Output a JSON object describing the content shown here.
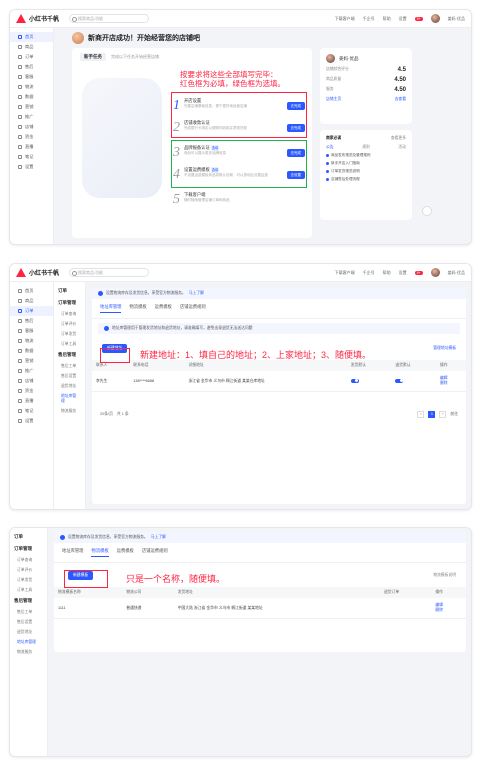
{
  "app": {
    "logo_text": "小红书千帆",
    "search_placeholder": "搜索商品/功能",
    "top_links": [
      "下载客户端",
      "千企号",
      "帮助",
      "设置"
    ],
    "user_name": "姜妈·优品",
    "notif_count": "9+"
  },
  "panel1": {
    "sidebar": [
      {
        "label": "首页",
        "active": true
      },
      {
        "label": "商品"
      },
      {
        "label": "订单"
      },
      {
        "label": "售后"
      },
      {
        "label": "客服"
      },
      {
        "label": "物流"
      },
      {
        "label": "数据"
      },
      {
        "label": "营销"
      },
      {
        "label": "推广"
      },
      {
        "label": "店铺"
      },
      {
        "label": "资金"
      },
      {
        "label": "直播"
      },
      {
        "label": "笔记"
      },
      {
        "label": "设置"
      }
    ],
    "welcome_title": "新商开店成功！开始经营您的店铺吧",
    "card_tab": "新手任务",
    "card_tab_hint": "完成以下任务开始经营店铺",
    "annotation": [
      "按要求将这些全部填写完毕：",
      "红色框为必填，绿色框为选填。"
    ],
    "steps": [
      {
        "num": "1",
        "title": "开店设置",
        "desc": "完善店铺基础信息，便于更好地经营店铺",
        "button": "去完成"
      },
      {
        "num": "2",
        "title": "店铺收款认证",
        "desc": "完成银行卡绑定以便顺利收款并提现货款",
        "button": "去完成"
      },
      {
        "num": "3",
        "title": "品牌报备认证",
        "tag": "选填",
        "desc": "商品可以展示更多品牌信息",
        "button": "去完成"
      },
      {
        "num": "4",
        "title": "设置运费模板",
        "tag": "选填",
        "desc": "不设置运费模板商品将默认包邮，可以按地区设置运费",
        "button": "去设置"
      },
      {
        "num": "5",
        "title": "下载客户端",
        "desc": "随时随地管理店铺订单和商品",
        "button": ""
      }
    ],
    "profile": {
      "name": "姜妈·优品",
      "score_label": "店铺综合评分",
      "score": "4.5",
      "row1_label": "商品质量",
      "row1_value": "4.50",
      "row2_label": "服务",
      "row2_value": "4.50",
      "footer_link": "店铺主页",
      "footer_btn": "去查看"
    },
    "todo": {
      "title": "商家必读",
      "link": "查看更多",
      "tabs": [
        "公告",
        "规则",
        "活动"
      ],
      "items": [
        "商品发布规范及管理规则",
        "新手开店入门指南",
        "订单发货规范说明",
        "店铺售后处理流程"
      ]
    }
  },
  "panel2": {
    "page_title": "订单",
    "subnav": {
      "group1": "订单管理",
      "group1_items": [
        "订单查询",
        "订单评价",
        "订单发货",
        "订单工具"
      ],
      "group2": "售后管理",
      "group2_items": [
        "售后工单",
        "售后设置",
        "退货地址",
        "地址库管理",
        "物流服务"
      ]
    },
    "notice": "设置物流库存及发货信息，享受官方物流服务。",
    "notice_link": "马上了解",
    "tabs": [
      "地址库管理",
      "物流模板",
      "运费模板",
      "店铺运费规则"
    ],
    "notice2": "地址库管理用于管理发货地址和退货地址，请准确填写，避免出现退货无法送达问题",
    "new_button": "新建地址",
    "right_link": "管理地址模板",
    "annotation": "新建地址：1、填自己的地址；2、上家地址；3、随便填。",
    "columns": [
      "联系人",
      "联系电话",
      "详细地址",
      "发货默认",
      "退货默认",
      "操作"
    ],
    "rows": [
      {
        "contact": "李先生",
        "phone": "138****6688",
        "address": "浙江省 金华市 义乌市 稠江街道 某某仓库地址",
        "ops": [
          "编辑",
          "删除"
        ]
      }
    ],
    "pager": {
      "total": "共 1 条",
      "page": "1",
      "size": "20条/页",
      "goto": "前往"
    }
  },
  "panel3": {
    "page_title": "订单",
    "notice": "设置物流库存及发货信息，享受官方物流服务。",
    "notice_link": "马上了解",
    "tabs": [
      "地址库管理",
      "物流模板",
      "运费模板",
      "店铺运费规则"
    ],
    "new_button": "新建模板",
    "right_link": "物流模板说明",
    "annotation": "只是一个名称，随便填。",
    "columns": [
      "物流模板名称",
      "物流公司",
      "发货地址",
      "退货订单",
      "操作"
    ],
    "rows": [
      {
        "name": "1111",
        "company": "普通快递",
        "address": "中国大陆 浙江省 金华市 义乌市 稠江街道 某某地址",
        "orders": "",
        "ops": [
          "编辑",
          "删除"
        ]
      }
    ]
  }
}
